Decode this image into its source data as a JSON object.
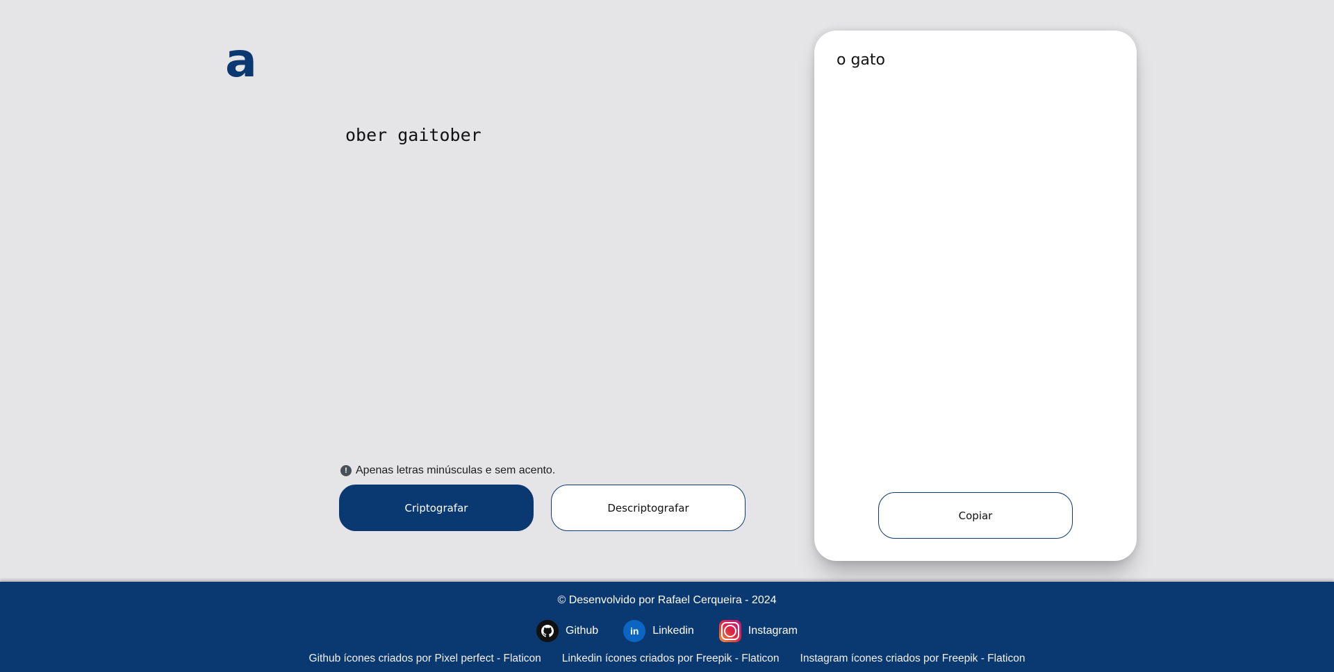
{
  "header": {
    "logo_text": "a"
  },
  "input": {
    "value": "ober gaitober"
  },
  "notice": {
    "icon": "exclamation-circle-icon",
    "text": "Apenas letras minúsculas e sem acento."
  },
  "buttons": {
    "encrypt_label": "Criptografar",
    "decrypt_label": "Descriptografar",
    "copy_label": "Copiar"
  },
  "result": {
    "text": "o gato"
  },
  "footer": {
    "copyright": "© Desenvolvido por Rafael Cerqueira - 2024",
    "social": [
      {
        "label": "Github",
        "icon": "github-icon"
      },
      {
        "label": "Linkedin",
        "icon": "linkedin-icon"
      },
      {
        "label": "Instagram",
        "icon": "instagram-icon"
      }
    ],
    "credits": [
      "Github ícones criados por Pixel perfect - Flaticon",
      "Linkedin ícones criados por Freepik - Flaticon",
      "Instagram ícones criados por Freepik - Flaticon"
    ]
  },
  "colors": {
    "primary": "#0a3871",
    "background": "#e5e5e7",
    "panel": "#ffffff"
  }
}
